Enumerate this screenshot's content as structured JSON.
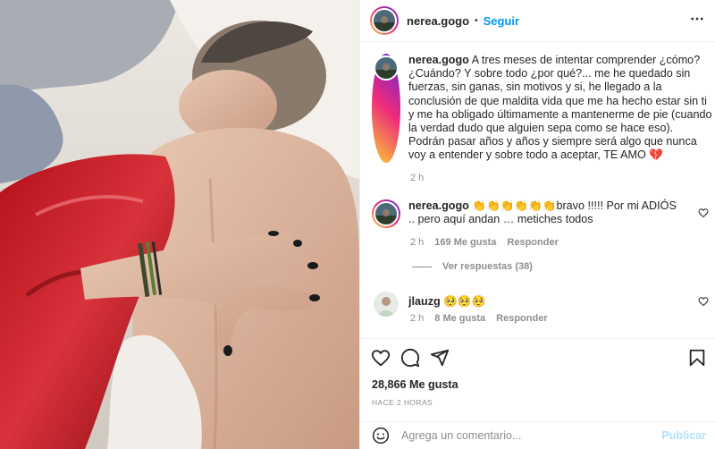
{
  "post": {
    "author": "nerea.gogo",
    "follow_label": "Seguir",
    "separator": "•",
    "more_icon": "more-horizontal-icon",
    "photo_alt": "Foto publicada por nerea.gogo",
    "caption": {
      "author": "nerea.gogo",
      "text": "A tres meses de intentar comprender ¿cómo? ¿Cuándo? Y sobre todo ¿por qué?... me he quedado sin fuerzas, sin ganas, sin motivos y si, he llegado a la conclusión de que maldita vida que me ha hecho estar sin ti y me ha obligado últimamente a mantenerme de pie (cuando la verdad dudo que alguien sepa como se hace eso). Podrán pasar años y años y siempre será algo que nunca voy a entender y sobre todo a aceptar, TE AMO 💔",
      "time": "2 h"
    },
    "comments": [
      {
        "author": "nerea.gogo",
        "text": "👏👏👏👏👏👏bravo !!!!! Por mi ADIÓS .. pero aquí andan … metiches todos",
        "time": "2 h",
        "likes": "169 Me gusta",
        "reply_label": "Responder",
        "view_replies": "Ver respuestas (38)"
      },
      {
        "author": "jlauzg",
        "text": "🥺🥺🥺",
        "time": "2 h",
        "likes": "8 Me gusta",
        "reply_label": "Responder"
      }
    ],
    "actions": {
      "like_icon": "heart-icon",
      "comment_icon": "comment-icon",
      "share_icon": "share-icon",
      "save_icon": "bookmark-icon"
    },
    "likes_count": "28,866 Me gusta",
    "posted_ago": "HACE 2 HORAS",
    "add_comment": {
      "placeholder": "Agrega un comentario...",
      "post_label": "Publicar",
      "emoji_icon": "emoji-icon"
    },
    "colors": {
      "link_blue": "#0095f6",
      "post_disabled": "#b2dffc",
      "muted": "#8e8e8e",
      "heart_broken": "#e0245e"
    }
  }
}
